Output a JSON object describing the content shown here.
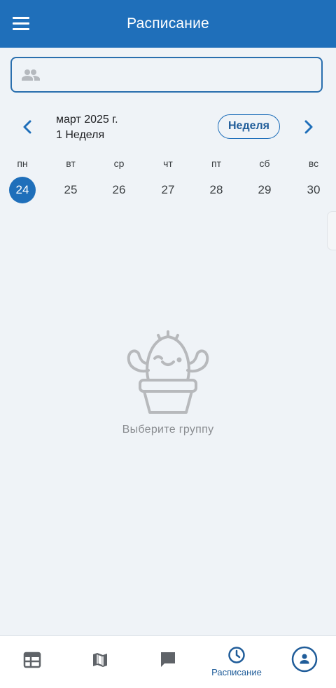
{
  "app": {
    "title": "Расписание"
  },
  "search": {
    "value": "",
    "icon": "group-icon"
  },
  "calendar": {
    "month": "март 2025 г.",
    "week": "1 Неделя",
    "view_button": "Неделя",
    "days": [
      {
        "name": "пн",
        "num": "24",
        "selected": true
      },
      {
        "name": "вт",
        "num": "25"
      },
      {
        "name": "ср",
        "num": "26"
      },
      {
        "name": "чт",
        "num": "27"
      },
      {
        "name": "пт",
        "num": "28"
      },
      {
        "name": "сб",
        "num": "29"
      },
      {
        "name": "вс",
        "num": "30"
      }
    ]
  },
  "empty_state": {
    "text": "Выберите группу",
    "icon": "cactus-icon"
  },
  "bottom_nav": [
    {
      "id": "schedule-list",
      "icon": "calendar-table-icon",
      "label": ""
    },
    {
      "id": "map",
      "icon": "map-icon",
      "label": ""
    },
    {
      "id": "chat",
      "icon": "chat-icon",
      "label": ""
    },
    {
      "id": "timetable",
      "icon": "clock-icon",
      "label": "Расписание",
      "active": true
    },
    {
      "id": "profile",
      "icon": "profile-icon",
      "label": ""
    }
  ],
  "colors": {
    "primary": "#1f6fba",
    "background": "#eff3f7",
    "muted": "#8a8d91"
  }
}
